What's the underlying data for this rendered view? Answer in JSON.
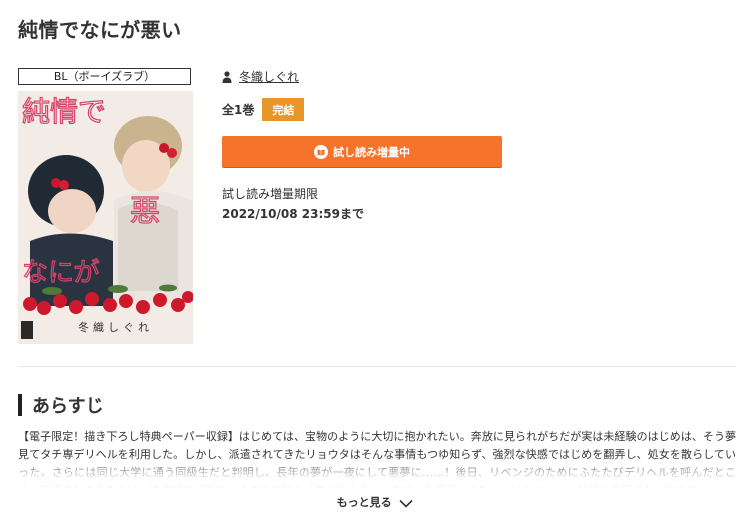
{
  "title": "純情でなにが悪い",
  "genre": "BL（ボーイズラブ）",
  "cover": {
    "title_art": "純情で なにが 悪い",
    "author_art": "冬織しぐれ"
  },
  "author": "冬織しぐれ",
  "volumes": "全1巻",
  "status_badge": "完結",
  "trial_button": "試し読み増量中",
  "trial_period": {
    "label": "試し読み増量期限",
    "date": "2022/10/08 23:59まで"
  },
  "synopsis_heading": "あらすじ",
  "synopsis": "【電子限定！描き下ろし特典ペーパー収録】はじめては、宝物のように大切に抱かれたい。奔放に見られがちだが実は未経験のはじめは、そう夢見てタチ専デリヘルを利用した。しかし、派遣されてきたリョウタはそんな事情もつゆ知らず、強烈な快感ではじめを翻弄し、処女を散らしていった。さらには同じ大学に通う同級生だと判明し、長年の夢が一夜にして悪夢に……！後日、リベンジのためにふたたびデリヘルを呼んだところ、派遣されてきたのは一晩中離れが悪中、まるで念願の「恋人同士のセックス」を実現してもらうけれど……と純情と欲望のあいだで揺",
  "more_button": "もっと見る",
  "colors": {
    "accent": "#f5732a",
    "badge": "#e8962a"
  }
}
